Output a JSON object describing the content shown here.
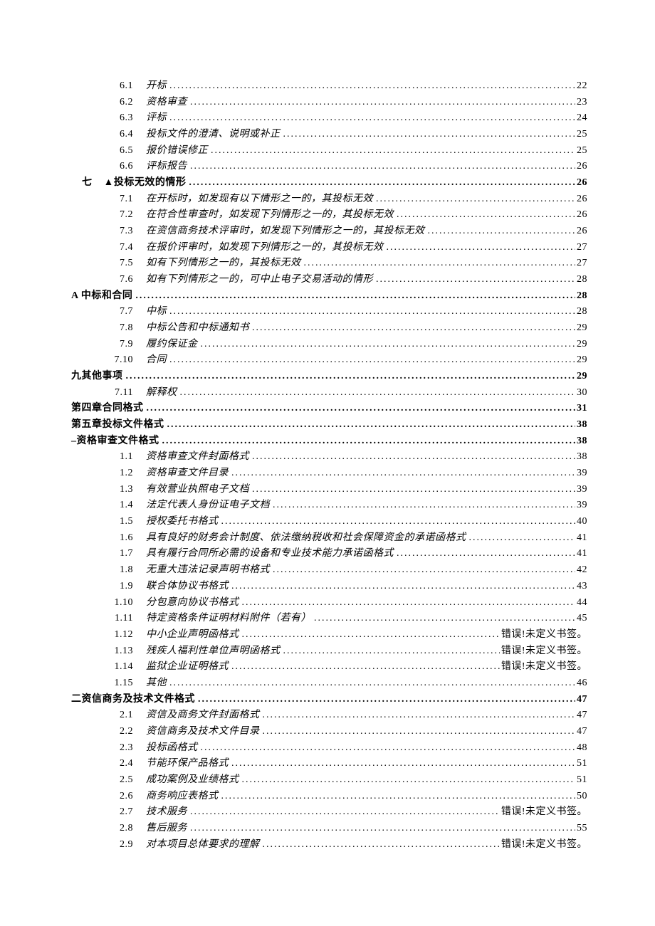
{
  "toc": {
    "six": [
      {
        "n": "6.1",
        "t": "开标",
        "p": "22"
      },
      {
        "n": "6.2",
        "t": "资格审查",
        "p": "23"
      },
      {
        "n": "6.3",
        "t": "评标",
        "p": "24"
      },
      {
        "n": "6.4",
        "t": "投标文件的澄清、说明或补正",
        "p": "25"
      },
      {
        "n": "6.5",
        "t": "报价错误修正",
        "p": "25"
      },
      {
        "n": "6.6",
        "t": "评标报告",
        "p": "26"
      }
    ],
    "seven_head": {
      "n": "七",
      "t": "▲投标无效的情形",
      "p": "26"
    },
    "seven": [
      {
        "n": "7.1",
        "t": "在开标时，如发现有以下情形之一的，其投标无效",
        "p": "26"
      },
      {
        "n": "7.2",
        "t": "在符合性审查时，如发现下列情形之一的，其投标无效",
        "p": "26"
      },
      {
        "n": "7.3",
        "t": "在资信商务技术评审时，如发现下列情形之一的，其投标无效",
        "p": "26"
      },
      {
        "n": "7.4",
        "t": "在报价评审时，如发现下列情形之一的，其投标无效",
        "p": "27"
      },
      {
        "n": "7.5",
        "t": "如有下列情形之一的，其投标无效",
        "p": "27"
      },
      {
        "n": "7.6",
        "t": "如有下列情形之一的，可中止电子交易活动的情形",
        "p": "28"
      }
    ],
    "a_head": {
      "t": "A 中标和合同",
      "p": "28"
    },
    "seven_b": [
      {
        "n": "7.7",
        "t": "中标",
        "p": "28"
      },
      {
        "n": "7.8",
        "t": "中标公告和中标通知书",
        "p": "29"
      },
      {
        "n": "7.9",
        "t": "履约保证金",
        "p": "29"
      },
      {
        "n": "7.10",
        "t": "合同",
        "p": "29"
      }
    ],
    "nine_head": {
      "t": "九其他事项",
      "p": "29"
    },
    "seven_c": [
      {
        "n": "7.11",
        "t": "解释权",
        "p": "30"
      }
    ],
    "ch4": {
      "t": "第四章合同格式",
      "p": "31"
    },
    "ch5": {
      "t": "第五章投标文件格式",
      "p": "38"
    },
    "sub_head": {
      "t": "–资格审查文件格式",
      "p": "38"
    },
    "one": [
      {
        "n": "1.1",
        "t": "资格审查文件封面格式",
        "p": "38"
      },
      {
        "n": "1.2",
        "t": "资格审查文件目录",
        "p": "39"
      },
      {
        "n": "1.3",
        "t": "有效营业执照电子文档",
        "p": "39"
      },
      {
        "n": "1.4",
        "t": "法定代表人身份证电子文档",
        "p": "39"
      },
      {
        "n": "1.5",
        "t": "授权委托书格式",
        "p": "40"
      },
      {
        "n": "1.6",
        "t": "具有良好的财务会计制度、依法缴纳税收和社会保障资金的承诺函格式",
        "p": "41"
      },
      {
        "n": "1.7",
        "t": "具有履行合同所必需的设备和专业技术能力承诺函格式",
        "p": "41"
      },
      {
        "n": "1.8",
        "t": "无重大违法记录声明书格式",
        "p": "42"
      },
      {
        "n": "1.9",
        "t": "联合体协议书格式",
        "p": "43"
      },
      {
        "n": "1.10",
        "t": "分包意向协议书格式",
        "p": "44"
      },
      {
        "n": "1.11",
        "t": "特定资格条件证明材料附件（若有）",
        "p": "45"
      },
      {
        "n": "1.12",
        "t": "中小企业声明函格式",
        "p": "错误!未定义书签。"
      },
      {
        "n": "1.13",
        "t": "残疾人福利性单位声明函格式",
        "p": "错误!未定义书签。"
      },
      {
        "n": "1.14",
        "t": "监狱企业证明格式",
        "p": "错误!未定义书签。"
      },
      {
        "n": "1.15",
        "t": "其他",
        "p": "46"
      }
    ],
    "two_head": {
      "t": "二资信商务及技术文件格式",
      "p": "47"
    },
    "two": [
      {
        "n": "2.1",
        "t": "资信及商务文件封面格式",
        "p": "47"
      },
      {
        "n": "2.2",
        "t": "资信商务及技术文件目录",
        "p": "47"
      },
      {
        "n": "2.3",
        "t": "投标函格式",
        "p": "48"
      },
      {
        "n": "2.4",
        "t": "节能环保产品格式",
        "p": "51"
      },
      {
        "n": "2.5",
        "t": "成功案例及业绩格式",
        "p": "51"
      },
      {
        "n": "2.6",
        "t": "商务响应表格式",
        "p": "50"
      },
      {
        "n": "2.7",
        "t": "技术服务",
        "p": "错误!未定义书签。"
      },
      {
        "n": "2.8",
        "t": "售后服务",
        "p": "55"
      },
      {
        "n": "2.9",
        "t": "对本项目总体要求的理解",
        "p": "错误!未定义书签。"
      }
    ]
  }
}
